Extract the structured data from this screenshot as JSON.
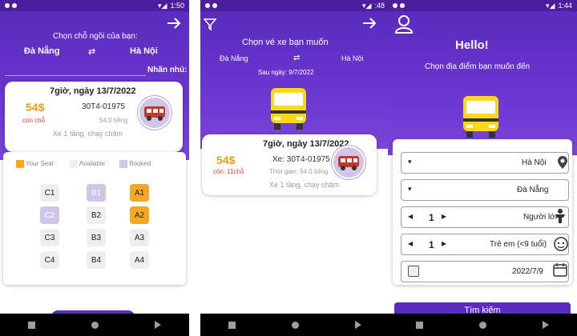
{
  "panel1": {
    "status_time": "1:50",
    "header_label": "Chọn chỗ ngồi của bạn:",
    "from_city": "Hà Nội",
    "to_city": "Đà Nẵng",
    "note_label": "Nhãn nhủ:",
    "trip": {
      "title": "7giờ, ngày 13/7/2022",
      "plate": "30T4-01975",
      "price": "54$",
      "remain": "còn chỗ",
      "duration": "54.0 tiếng",
      "description": "Xe 1 tầng, chạy chậm"
    },
    "legend": {
      "booked": "Booked",
      "available": "Available",
      "your_seat": "Your Seat"
    },
    "seats": {
      "c1": "C1",
      "b1": "B1",
      "a1": "A1",
      "c2": "C2",
      "b2": "B2",
      "a2": "A2",
      "c3": "C3",
      "b3": "B3",
      "a3": "A3",
      "c4": "C4",
      "b4": "B4",
      "a4": "A4"
    }
  },
  "panel2": {
    "status_time": ":48",
    "header_label": "Chọn vé xe bạn muốn",
    "from_city": "Hà Nội",
    "to_city": "Đà Nẵng",
    "date_label": "Sau ngày: 9/7/2022",
    "trip": {
      "title": "7giờ, ngày 13/7/2022",
      "plate": "Xe: 30T4-01975",
      "price": "54$",
      "remain": "còn: 11chỗ",
      "duration": "Thời gian: 54.0 tiếng",
      "description": "Xe 1 tầng, chạy chậm"
    }
  },
  "panel3": {
    "status_time": "1:44",
    "hello": "Hello!",
    "subtitle": "Chọn địa điểm bạn muốn đến",
    "from_value": "Hà Nội",
    "to_value": "Đà Nẵng",
    "adults_count": "1",
    "adults_label": "Người lớn",
    "children_count": "1",
    "children_label": "Trẻ em (<9 tuổi)",
    "date_value": "2022/7/9",
    "search_button": "Tìm kiếm"
  },
  "colors": {
    "header_purple": "#6a35cf",
    "status_purple": "#4b1e9e",
    "seat_orange": "#f5a623",
    "seat_booked": "#d1c4e9",
    "price_orange": "#f39c12",
    "remain_red": "#e53935"
  }
}
